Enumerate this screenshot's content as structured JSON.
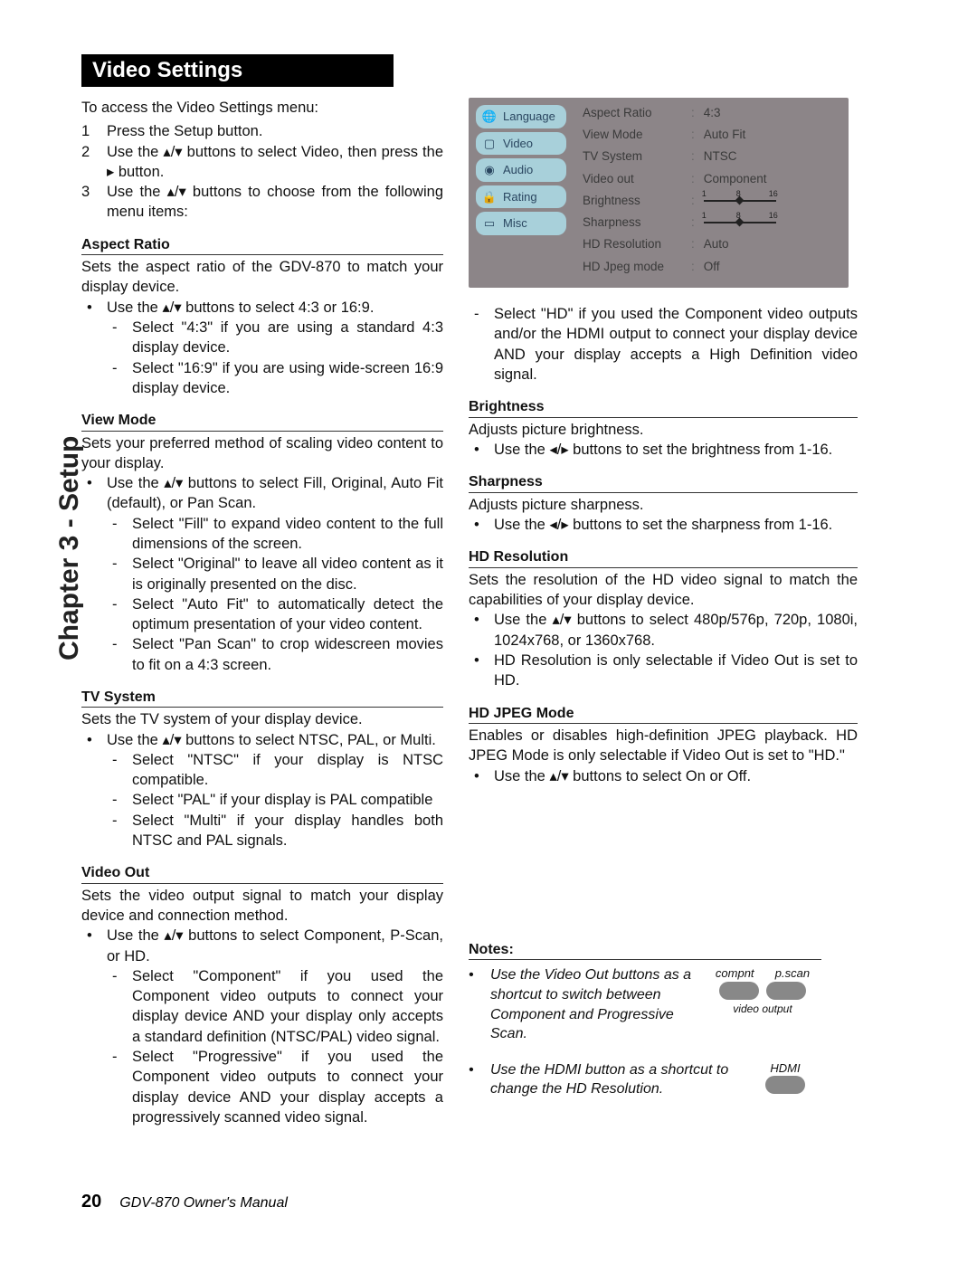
{
  "sidebar": "Chapter 3 - Setup",
  "title": "Video Settings",
  "intro": "To access the Video Settings menu:",
  "steps": [
    "Press the Setup button.",
    "Use the ▴/▾ buttons to select Video, then press the ▸ button.",
    "Use the ▴/▾ buttons to choose from the following menu items:"
  ],
  "sections": {
    "aspect": {
      "h": "Aspect Ratio",
      "d": "Sets the aspect ratio of the GDV-870 to match your display device.",
      "b1": "Use the ▴/▾ buttons to select 4:3 or 16:9.",
      "s1": "Select \"4:3\" if you are using a standard 4:3 display device.",
      "s2": "Select \"16:9\" if you are using wide-screen 16:9 display device."
    },
    "view": {
      "h": "View Mode",
      "d": "Sets your preferred method of scaling video content to your display.",
      "b1": "Use the ▴/▾ buttons to select Fill, Original, Auto Fit (default), or Pan Scan.",
      "s1": "Select \"Fill\" to expand video content to the full dimensions of the screen.",
      "s2": "Select \"Original\" to leave all video content as it is originally presented on the disc.",
      "s3": "Select \"Auto Fit\" to automatically detect the optimum presentation of your video content.",
      "s4": "Select \"Pan Scan\" to crop widescreen movies to fit on a 4:3 screen."
    },
    "tv": {
      "h": "TV System",
      "d": "Sets the TV system of your display device.",
      "b1": "Use the ▴/▾ buttons to select NTSC, PAL, or Multi.",
      "s1": "Select \"NTSC\" if your display is NTSC compatible.",
      "s2": "Select \"PAL\" if your display is PAL compatible",
      "s3": "Select \"Multi\" if your display handles both NTSC and PAL signals."
    },
    "vout": {
      "h": "Video Out",
      "d": "Sets the video output signal to match your display device and connection method.",
      "b1": "Use the ▴/▾ buttons to select Component, P-Scan, or HD.",
      "s1": "Select \"Component\" if you used the Component video outputs to connect your display device AND your display only accepts a standard definition (NTSC/PAL) video signal.",
      "s2": "Select \"Progressive\" if you used the Component video outputs to connect your display device AND your display accepts a progressively scanned video signal.",
      "s3": "Select \"HD\" if you used the Component video outputs and/or the HDMI output to connect your display device AND your display accepts a High Definition video signal."
    },
    "bright": {
      "h": "Brightness",
      "d": "Adjusts picture brightness.",
      "b1": "Use the ◂/▸ buttons to set the brightness from 1-16."
    },
    "sharp": {
      "h": "Sharpness",
      "d": "Adjusts picture sharpness.",
      "b1": "Use the ◂/▸ buttons to set the sharpness from 1-16."
    },
    "hdres": {
      "h": "HD Resolution",
      "d": "Sets the resolution of the HD video signal to match the capabilities of your display device.",
      "b1": "Use the ▴/▾ buttons to select 480p/576p, 720p, 1080i, 1024x768, or 1360x768.",
      "b2": "HD Resolution is only selectable if Video Out is set to HD."
    },
    "hdjpeg": {
      "h": "HD JPEG Mode",
      "d": "Enables or disables high-definition JPEG playback. HD JPEG Mode is only selectable if Video Out is set to \"HD.\"",
      "b1": "Use the ▴/▾ buttons to select On or Off."
    }
  },
  "osd": {
    "tabs": [
      "Language",
      "Video",
      "Audio",
      "Rating",
      "Misc"
    ],
    "rows": [
      {
        "k": "Aspect Ratio",
        "v": "4:3"
      },
      {
        "k": "View Mode",
        "v": "Auto Fit"
      },
      {
        "k": "TV System",
        "v": "NTSC"
      },
      {
        "k": "Video out",
        "v": "Component"
      },
      {
        "k": "Brightness",
        "slider": {
          "min": "1",
          "mid": "8",
          "max": "16",
          "pos": 48
        }
      },
      {
        "k": "Sharpness",
        "slider": {
          "min": "1",
          "mid": "8",
          "max": "16",
          "pos": 48
        }
      },
      {
        "k": "HD Resolution",
        "v": "Auto"
      },
      {
        "k": "HD Jpeg mode",
        "v": "Off"
      }
    ]
  },
  "notes": {
    "h": "Notes:",
    "n1": "Use the Video Out buttons as a shortcut to switch between Component and Progressive Scan.",
    "n2": "Use the HDMI button as a shortcut to change the HD Resolution.",
    "labels": {
      "compnt": "compnt",
      "pscan": "p.scan",
      "vout": "video output",
      "hdmi": "HDMI"
    }
  },
  "footer": {
    "page": "20",
    "manual": "GDV-870 Owner's Manual"
  }
}
